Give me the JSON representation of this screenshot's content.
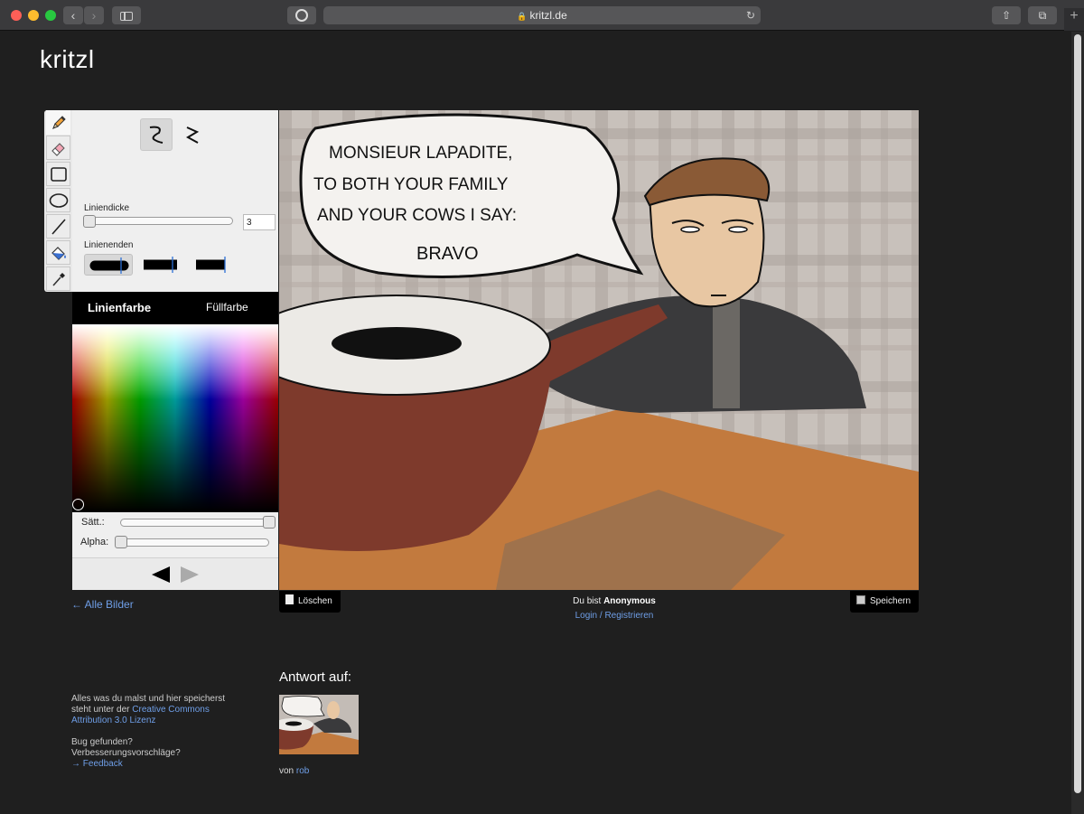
{
  "browser": {
    "url": "kritzl.de"
  },
  "site": {
    "logo": "kritzl"
  },
  "tools": {
    "items": [
      "pencil-icon",
      "eraser-icon",
      "rectangle-icon",
      "ellipse-icon",
      "line-icon",
      "fill-bucket-icon",
      "eyedropper-icon"
    ]
  },
  "brush_panel": {
    "thickness_label": "Liniendicke",
    "thickness_value": "3",
    "line_ends_label": "Linienenden"
  },
  "color_panel": {
    "line_color_tab": "Linienfarbe",
    "fill_color_tab": "Füllfarbe",
    "saturation_label": "Sätt.:",
    "alpha_label": "Alpha:"
  },
  "nav": {
    "back_link": "← Alle Bilder"
  },
  "canvas": {
    "speech_line1": "MONSIEUR LAPADITE,",
    "speech_line2": "TO BOTH YOUR FAMILY",
    "speech_line3": "AND YOUR COWS I SAY:",
    "speech_line4": "BRAVO"
  },
  "actions": {
    "clear_label": "Löschen",
    "save_label": "Speichern"
  },
  "user": {
    "prefix": "Du bist",
    "name": "Anonymous",
    "login_label": "Login",
    "separator": "/",
    "register_label": "Registrieren"
  },
  "reply": {
    "title": "Antwort auf:",
    "by_prefix": "von",
    "author": "rob"
  },
  "footer": {
    "license_text": "Alles was du malst und hier speicherst steht unter der",
    "license_link": "Creative Commons Attribution 3.0 Lizenz",
    "bug_text": "Bug gefunden? Verbesserungsvorschläge?",
    "feedback_link": "→ Feedback"
  },
  "colors": {
    "link": "#6f9fe8",
    "background": "#1f1f1f"
  }
}
